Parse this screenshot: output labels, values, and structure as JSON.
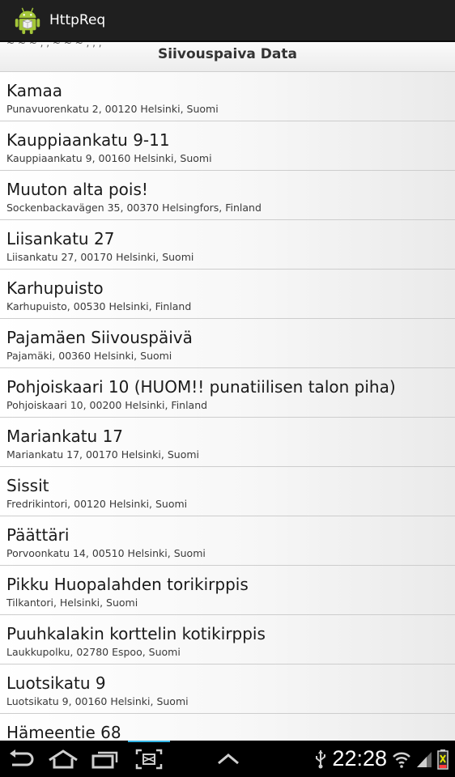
{
  "app": {
    "title": "HttpReq",
    "icon": "android-robot-icon"
  },
  "list_header": {
    "title": "Siivouspaiva Data",
    "peek_text": "~ ~ ~ ,     , ~ ~ ~ ,  ,      ,"
  },
  "items": [
    {
      "title": "Kamaa",
      "address": "Punavuorenkatu 2, 00120 Helsinki, Suomi"
    },
    {
      "title": "Kauppiaankatu 9-11",
      "address": "Kauppiaankatu 9, 00160 Helsinki, Suomi"
    },
    {
      "title": "Muuton alta pois!",
      "address": "Sockenbackavägen 35, 00370 Helsingfors, Finland"
    },
    {
      "title": "Liisankatu 27",
      "address": "Liisankatu 27, 00170 Helsinki, Suomi"
    },
    {
      "title": "Karhupuisto",
      "address": "Karhupuisto, 00530 Helsinki, Finland"
    },
    {
      "title": "Pajamäen Siivouspäivä",
      "address": "Pajamäki, 00360 Helsinki, Suomi"
    },
    {
      "title": "Pohjoiskaari 10 (HUOM!! punatiilisen talon piha)",
      "address": "Pohjoiskaari 10, 00200 Helsinki, Finland"
    },
    {
      "title": "Mariankatu 17",
      "address": "Mariankatu 17, 00170 Helsinki, Suomi"
    },
    {
      "title": "Sissit",
      "address": "Fredrikintori, 00120 Helsinki, Suomi"
    },
    {
      "title": "Päättäri",
      "address": "Porvoonkatu 14, 00510 Helsinki, Suomi"
    },
    {
      "title": "Pikku Huopalahden torikirppis",
      "address": "Tilkantori, Helsinki, Suomi"
    },
    {
      "title": "Puuhkalakin korttelin kotikirppis",
      "address": "Laukkupolku, 02780 Espoo, Suomi"
    },
    {
      "title": "Luotsikatu 9",
      "address": "Luotsikatu 9, 00160 Helsinki, Suomi"
    },
    {
      "title": "Hämeentie 68",
      "address": ""
    }
  ],
  "status_bar": {
    "time": "22:28",
    "icons": [
      "usb-icon",
      "wifi-icon",
      "signal-icon",
      "battery-icon"
    ]
  },
  "nav": {
    "buttons": [
      "back-icon",
      "home-icon",
      "recent-apps-icon",
      "screenshot-icon",
      "menu-up-icon"
    ]
  },
  "colors": {
    "accent": "#33b5e5",
    "android_green": "#a4c639",
    "battery_low": "#ff3b3b"
  }
}
